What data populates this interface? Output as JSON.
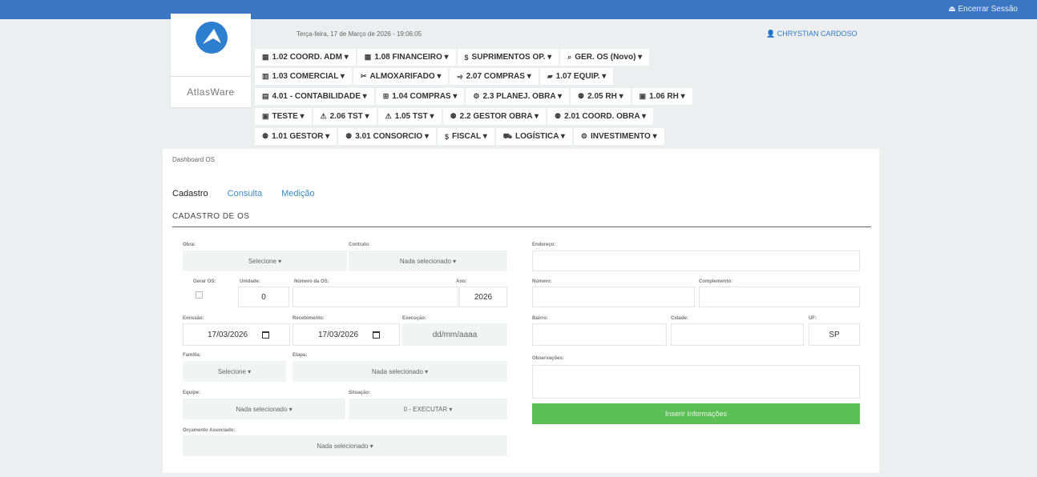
{
  "topbar": {
    "logout": "Encerrar Sessão"
  },
  "brand": {
    "name": "AtlasWare"
  },
  "header": {
    "date": "Terça-feira, 17 de Março de 2026 - 19:06:05",
    "user": "CHRYSTIAN CARDOSO"
  },
  "menu": [
    [
      {
        "icon": "▦",
        "label": "1.02 COORD. ADM ▾"
      },
      {
        "icon": "▦",
        "label": "1.08 FINANCEIRO ▾"
      },
      {
        "icon": "$",
        "label": "SUPRIMENTOS OP. ▾"
      },
      {
        "icon": "⌕",
        "label": "GER. OS (Novo) ▾"
      }
    ],
    [
      {
        "icon": "▥",
        "label": "1.03 COMERCIAL ▾"
      },
      {
        "icon": "✂",
        "label": "ALMOXARIFADO ▾"
      },
      {
        "icon": "⥤",
        "label": "2.07 COMPRAS ▾"
      },
      {
        "icon": "▰",
        "label": "1.07 EQUIP. ▾"
      }
    ],
    [
      {
        "icon": "▤",
        "label": "4.01 - CONTABILIDADE ▾"
      },
      {
        "icon": "⊞",
        "label": "1.04 COMPRAS ▾"
      },
      {
        "icon": "⚙",
        "label": "2.3 PLANEJ. OBRA ▾"
      },
      {
        "icon": "⚉",
        "label": "2.05 RH ▾"
      },
      {
        "icon": "▣",
        "label": "1.06 RH ▾"
      }
    ],
    [
      {
        "icon": "▣",
        "label": "TESTE ▾"
      },
      {
        "icon": "⚠",
        "label": "2.06 TST ▾"
      },
      {
        "icon": "⚠",
        "label": "1.05 TST ▾"
      },
      {
        "icon": "⚉",
        "label": "2.2 GESTOR OBRA ▾"
      },
      {
        "icon": "⚉",
        "label": "2.01 COORD. OBRA ▾"
      }
    ],
    [
      {
        "icon": "⚉",
        "label": "1.01 GESTOR ▾"
      },
      {
        "icon": "⚉",
        "label": "3.01 CONSORCIO ▾"
      },
      {
        "icon": "$",
        "label": "FISCAL ▾"
      },
      {
        "icon": "⛟",
        "label": "LOGÍSTICA ▾"
      },
      {
        "icon": "⚙",
        "label": "INVESTIMENTO ▾"
      }
    ]
  ],
  "page": {
    "breadcrumb": "Dashboard OS",
    "tabs": [
      "Cadastro",
      "Consulta",
      "Medição"
    ],
    "section": "CADASTRO DE OS"
  },
  "form": {
    "obra_label": "Obra:",
    "obra": "Selecione ▾",
    "contrato_label": "Contrato:",
    "contrato": "Nada selecionado ▾",
    "gerar_label": "Gerar OS:",
    "unidade_label": "Unidade:",
    "unidade": "0",
    "numero_label": "Número da OS:",
    "ano_label": "Ano:",
    "ano": "2026",
    "emissao_label": "Emissão:",
    "emissao": "17/03/2026",
    "recebimento_label": "Recebimento:",
    "recebimento": "17/03/2026",
    "execucao_label": "Execução:",
    "execucao": "dd/mm/aaaa",
    "familia_label": "Família:",
    "familia": "Selecione ▾",
    "etapa_label": "Etapa:",
    "etapa": "Nada selecionado ▾",
    "equipe_label": "Equipe:",
    "equipe": "Nada selecionado ▾",
    "situacao_label": "Situação:",
    "situacao": "0 - EXECUTAR ▾",
    "orcamento_label": "Orçamento Associado:",
    "orcamento": "Nada selecionado ▾",
    "endereco_label": "Endereço:",
    "numero_end_label": "Número:",
    "complemento_label": "Complemento:",
    "bairro_label": "Bairro:",
    "cidade_label": "Cidade:",
    "uf_label": "UF:",
    "uf": "SP",
    "obs_label": "Observações:",
    "submit": "Inserir Informações"
  }
}
